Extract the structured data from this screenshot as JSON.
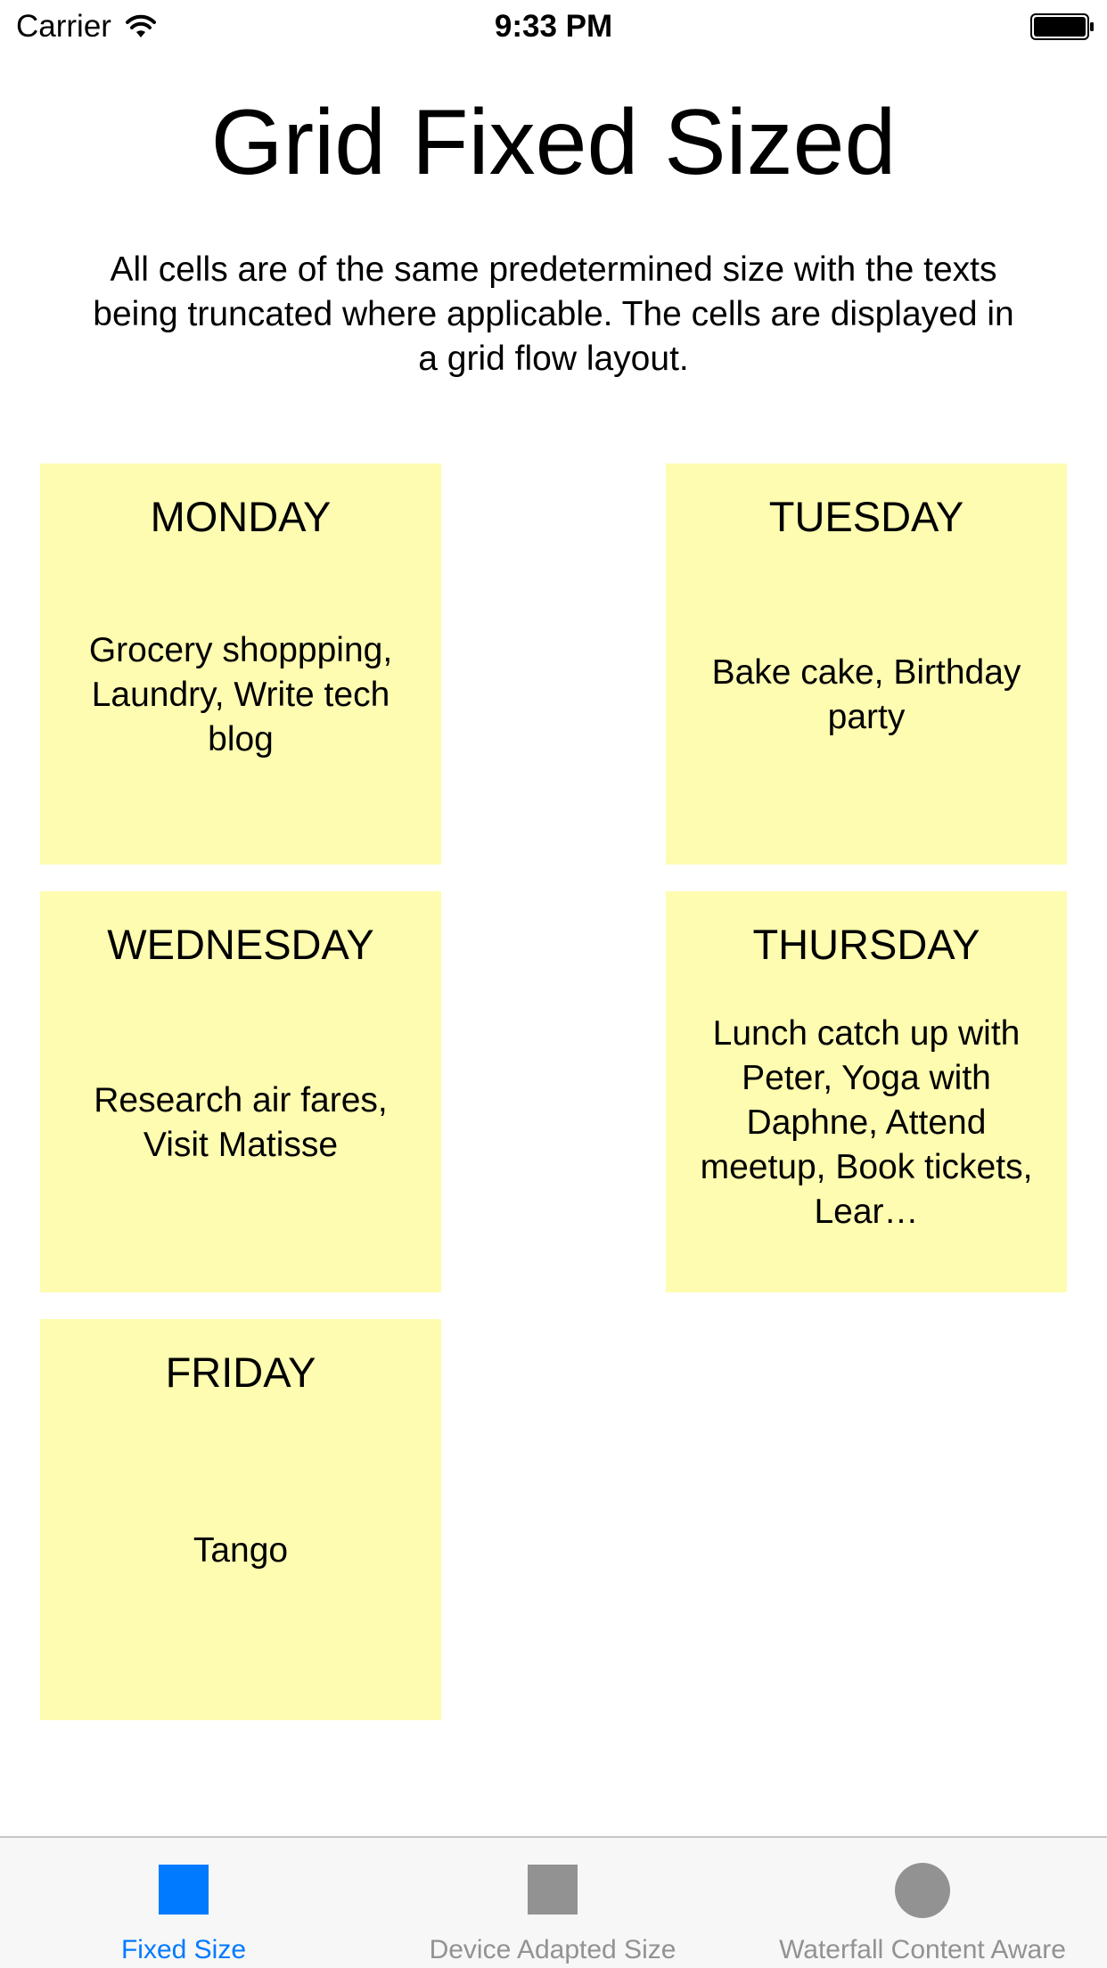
{
  "status_bar": {
    "carrier": "Carrier",
    "time": "9:33 PM"
  },
  "header": {
    "title": "Grid Fixed Sized",
    "description": "All cells are of the same predetermined size with the texts being truncated where applicable. The cells are displayed in a grid flow layout."
  },
  "cells": [
    {
      "day": "MONDAY",
      "tasks": "Grocery shoppping, Laundry, Write tech blog"
    },
    {
      "day": "TUESDAY",
      "tasks": "Bake cake, Birthday party"
    },
    {
      "day": "WEDNESDAY",
      "tasks": "Research air fares, Visit Matisse"
    },
    {
      "day": "THURSDAY",
      "tasks": "Lunch catch up with Peter, Yoga with Daphne, Attend meetup, Book tickets, Lear…"
    },
    {
      "day": "FRIDAY",
      "tasks": "Tango"
    }
  ],
  "tab_bar": {
    "tabs": [
      {
        "label": "Fixed Size",
        "icon": "square-icon",
        "selected": true
      },
      {
        "label": "Device Adapted Size",
        "icon": "square-icon",
        "selected": false
      },
      {
        "label": "Waterfall Content Aware",
        "icon": "circle-icon",
        "selected": false
      }
    ]
  },
  "colors": {
    "cell_background": "#fefcb0",
    "tab_selected": "#007aff",
    "tab_unselected": "#929292",
    "tab_bar_background": "#f7f7f7"
  }
}
